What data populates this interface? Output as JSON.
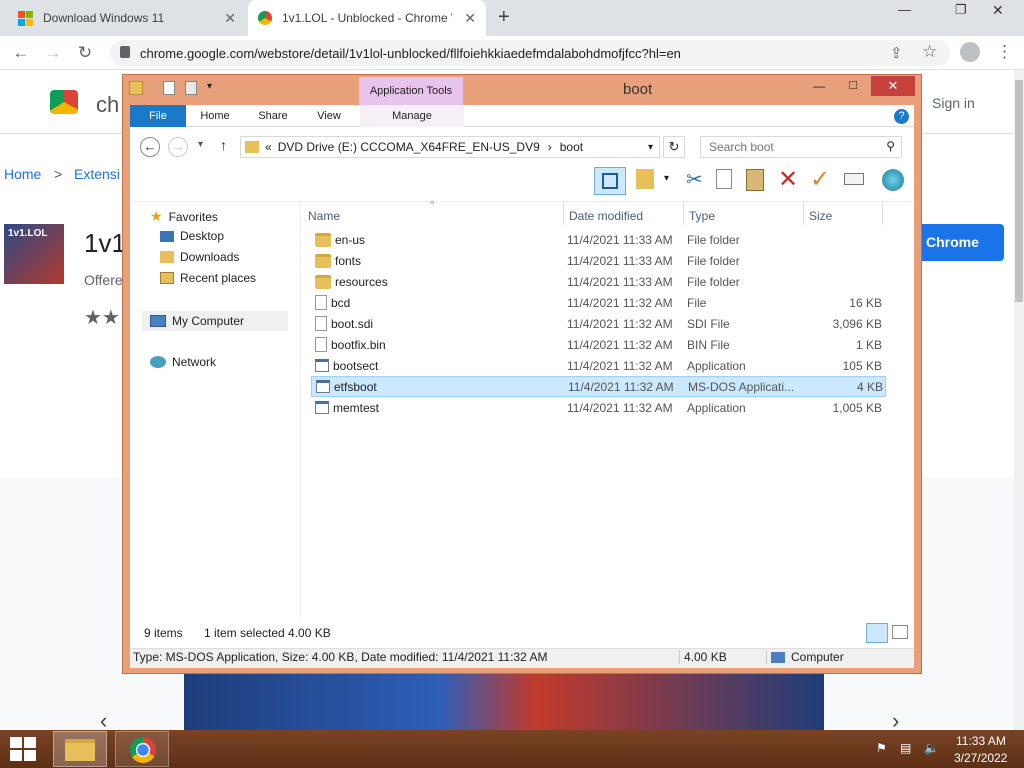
{
  "chrome": {
    "tabs": [
      {
        "title": "Download Windows 11"
      },
      {
        "title": "1v1.LOL - Unblocked - Chrome W"
      }
    ],
    "new_tab": "+",
    "url": "chrome.google.com/webstore/detail/1v1lol-unblocked/fllfoiehkkiaedefmdalabohdmofjfcc?hl=en",
    "window_controls": {
      "min": "—",
      "max": "❐",
      "close": "✕"
    }
  },
  "store": {
    "logo_text": "ch",
    "sign_in": "Sign in",
    "breadcrumb": {
      "home": "Home",
      "sep": ">",
      "ext": "Extensi"
    },
    "app_title": "1v1.",
    "offered": "Offere",
    "stars": "★★",
    "add_button": "Chrome",
    "icon_text": "1v1.LOL"
  },
  "explorer": {
    "title": "boot",
    "app_tools": "Application Tools",
    "ribbon_tabs": [
      "File",
      "Home",
      "Share",
      "View",
      "Manage"
    ],
    "path_prefix": "«",
    "path_drive": "DVD Drive (E:) CCCOMA_X64FRE_EN-US_DV9",
    "path_sep": "›",
    "path_folder": "boot",
    "search_placeholder": "Search boot",
    "columns": {
      "name": "Name",
      "date": "Date modified",
      "type": "Type",
      "size": "Size"
    },
    "nav": {
      "favorites": "Favorites",
      "desktop": "Desktop",
      "downloads": "Downloads",
      "recent": "Recent places",
      "computer": "My Computer",
      "network": "Network"
    },
    "files": [
      {
        "name": "en-us",
        "date": "11/4/2021 11:33 AM",
        "type": "File folder",
        "size": "",
        "icon": "folder"
      },
      {
        "name": "fonts",
        "date": "11/4/2021 11:33 AM",
        "type": "File folder",
        "size": "",
        "icon": "folder"
      },
      {
        "name": "resources",
        "date": "11/4/2021 11:33 AM",
        "type": "File folder",
        "size": "",
        "icon": "folder"
      },
      {
        "name": "bcd",
        "date": "11/4/2021 11:32 AM",
        "type": "File",
        "size": "16 KB",
        "icon": "doc"
      },
      {
        "name": "boot.sdi",
        "date": "11/4/2021 11:32 AM",
        "type": "SDI File",
        "size": "3,096 KB",
        "icon": "doc"
      },
      {
        "name": "bootfix.bin",
        "date": "11/4/2021 11:32 AM",
        "type": "BIN File",
        "size": "1 KB",
        "icon": "doc"
      },
      {
        "name": "bootsect",
        "date": "11/4/2021 11:32 AM",
        "type": "Application",
        "size": "105 KB",
        "icon": "app"
      },
      {
        "name": "etfsboot",
        "date": "11/4/2021 11:32 AM",
        "type": "MS-DOS Applicati...",
        "size": "4 KB",
        "icon": "app",
        "selected": true
      },
      {
        "name": "memtest",
        "date": "11/4/2021 11:32 AM",
        "type": "Application",
        "size": "1,005 KB",
        "icon": "app"
      }
    ],
    "status": {
      "items": "9 items",
      "selected": "1 item selected  4.00 KB",
      "details": "Type: MS-DOS Application, Size: 4.00 KB, Date modified: 11/4/2021 11:32 AM",
      "size": "4.00 KB",
      "location": "Computer"
    }
  },
  "taskbar": {
    "time": "11:33 AM",
    "date": "3/27/2022"
  }
}
